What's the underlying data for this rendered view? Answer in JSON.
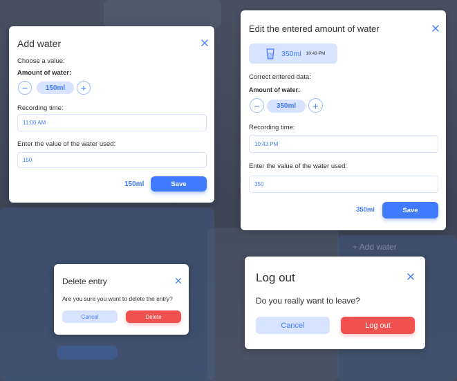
{
  "add_water": {
    "title": "Add water",
    "choose_label": "Choose a value:",
    "amount_label": "Amount of water:",
    "amount_value": "150ml",
    "minus": "−",
    "plus": "+",
    "time_label": "Recording time:",
    "time_value": "11:00 AM",
    "water_used_label": "Enter the value of the water used:",
    "water_used_value": "150",
    "total": "150ml",
    "save_label": "Save"
  },
  "edit_water": {
    "title": "Edit the entered amount of water",
    "entry_amount": "350ml",
    "entry_time": "10:43 PM",
    "correct_label": "Correct entered data:",
    "amount_label": "Amount of water:",
    "amount_value": "350ml",
    "minus": "−",
    "plus": "+",
    "time_label": "Recording time:",
    "time_value": "10:43 PM",
    "water_used_label": "Enter the value of the water used:",
    "water_used_value": "350",
    "total": "350ml",
    "save_label": "Save"
  },
  "delete_entry": {
    "title": "Delete entry",
    "message": "Are you sure you want to delete the entry?",
    "cancel_label": "Cancel",
    "delete_label": "Delete"
  },
  "log_out": {
    "title": "Log out",
    "message": "Do you really want to leave?",
    "cancel_label": "Cancel",
    "logout_label": "Log out"
  },
  "background": {
    "add_water_link": "+ Add water"
  },
  "colors": {
    "accent": "#407bff",
    "accent_light": "#d7e3ff",
    "danger": "#ef5050"
  },
  "icons": [
    "close-icon",
    "glass-icon",
    "plus-icon",
    "minus-icon"
  ]
}
